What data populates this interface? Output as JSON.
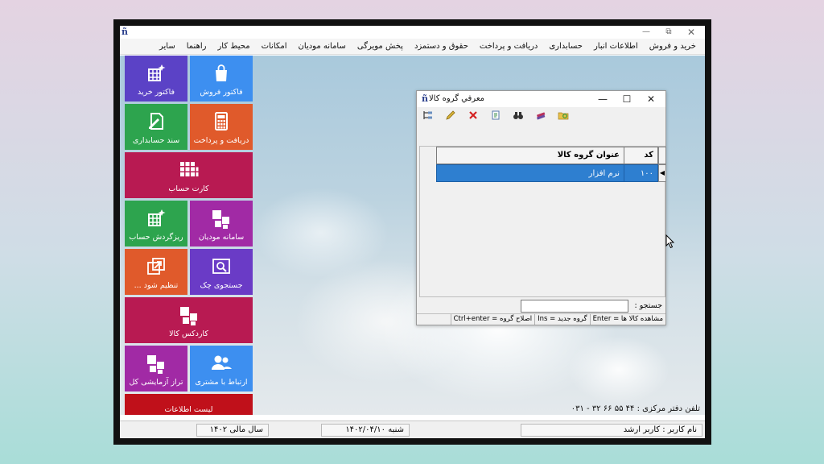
{
  "app": {
    "menu": [
      "خرید و فروش",
      "اطلاعات انبار",
      "حسابداری",
      "دریافت و پرداخت",
      "حقوق و دستمزد",
      "پخش مویرگی",
      "سامانه مودیان",
      "امکانات",
      "محیط کار",
      "راهنما",
      "سایر"
    ]
  },
  "tiles": [
    {
      "label": "فاکتور خرید",
      "color": "#5b42c6",
      "icon": "cube-sparkle-icon"
    },
    {
      "label": "فاکتور فروش",
      "color": "#3d8ff0",
      "icon": "shopping-bag-icon"
    },
    {
      "label": "سند حسابداری",
      "color": "#2da44e",
      "icon": "document-pen-icon"
    },
    {
      "label": "دریافت و پرداخت",
      "color": "#e05a2b",
      "icon": "calculator-icon"
    },
    {
      "label": "کارت حساب",
      "color": "#b81a52",
      "icon": "grid-icon"
    },
    {
      "label": "ریزگردش حساب",
      "color": "#2da44e",
      "icon": "cube-sparkle-icon"
    },
    {
      "label": "سامانه مودیان",
      "color": "#a12aa5",
      "icon": "squares-icon"
    },
    {
      "label": "تنظیم شود ...",
      "color": "#e05a2b",
      "icon": "window-arrow-icon"
    },
    {
      "label": "جستجوی چک",
      "color": "#6a3bc6",
      "icon": "search-window-icon"
    },
    {
      "label": "کاردکس کالا",
      "color": "#b81a52",
      "icon": "squares-icon"
    },
    {
      "label": "تراز آزمایشی کل",
      "color": "#a12aa5",
      "icon": "squares-icon"
    },
    {
      "label": "ارتباط با مشتری",
      "color": "#3d8ff0",
      "icon": "users-icon"
    },
    {
      "label": "لیست اطلاعات",
      "color": "#c0101a",
      "icon": "none"
    }
  ],
  "dialog": {
    "title": "معرفي گروه كالا",
    "toolbar_icons": [
      "tree-icon",
      "pencil-icon",
      "delete-x-icon",
      "print-icon",
      "binoculars-icon",
      "books-icon",
      "folder-refresh-icon"
    ],
    "columns": [
      "کد گروه",
      "عنوان گروه کالا"
    ],
    "rows": [
      {
        "code": "۱۰۰",
        "title": "نرم افزار"
      }
    ],
    "search_label": "جستجو :",
    "hints": [
      "مشاهده کالا ها = Enter",
      "گروه جدید = Ins",
      "اصلاح گروه = Ctrl+enter"
    ]
  },
  "phone": "تلفن دفتر مرکزی  :  ۴۴ ۵۵ ۶۶ ۳۲ - ۰۳۱",
  "status": {
    "user": "نام کاربر : کاربر ارشد",
    "date": "شنبه  ۱۴۰۲/۰۴/۱۰",
    "fiscal_year": "سال مالی ۱۴۰۲"
  }
}
